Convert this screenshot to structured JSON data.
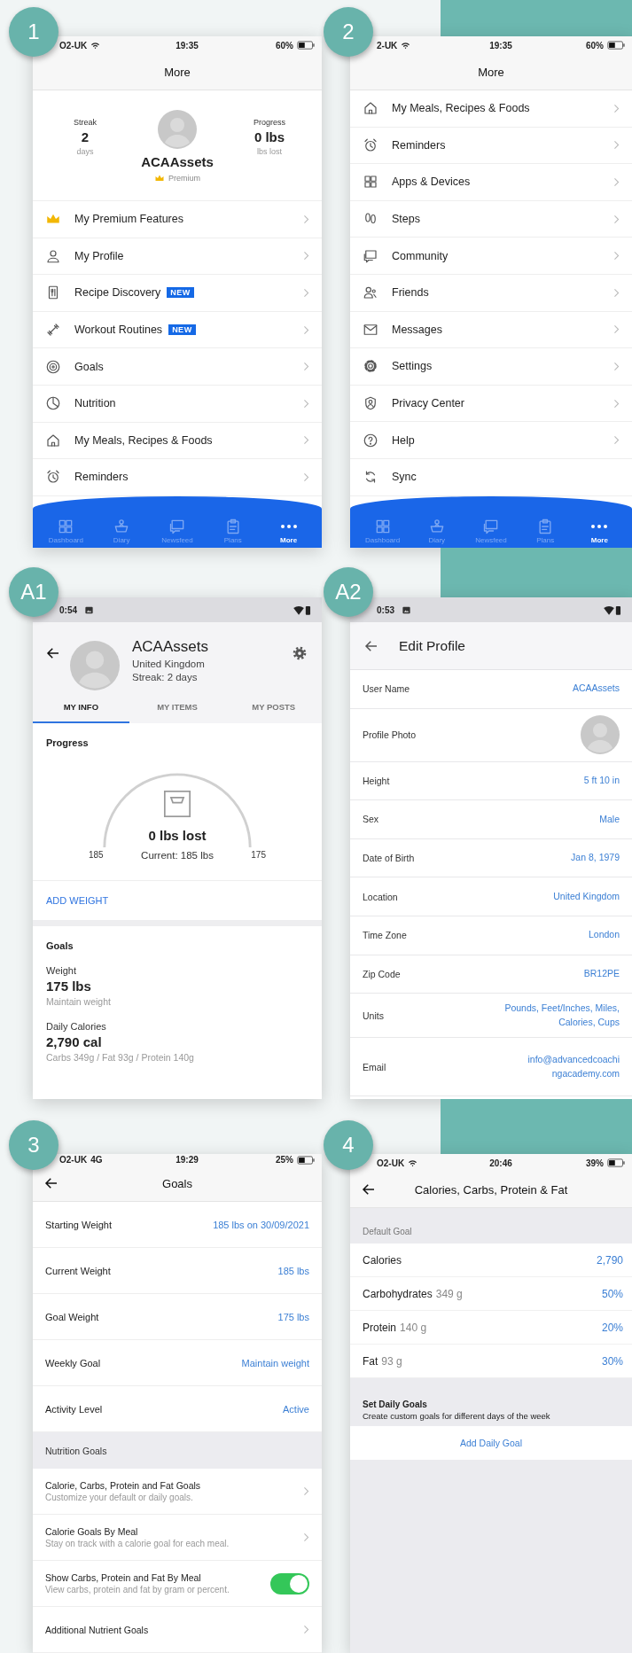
{
  "panels": [
    {
      "badge": "1",
      "kind": "ios_more_profile",
      "status": {
        "carrier": "O2-UK",
        "time": "19:35",
        "battery": "60%"
      },
      "title": "More",
      "profile": {
        "streak_label": "Streak",
        "streak_value": "2",
        "streak_unit": "days",
        "name": "ACAAssets",
        "tier": "Premium",
        "progress_label": "Progress",
        "progress_value": "0 lbs",
        "progress_unit": "lbs lost"
      },
      "menu": [
        {
          "label": "My Premium Features",
          "chevron": true
        },
        {
          "label": "My Profile",
          "chevron": true
        },
        {
          "label": "Recipe Discovery",
          "badge": "NEW",
          "chevron": true
        },
        {
          "label": "Workout Routines",
          "badge": "NEW",
          "chevron": true
        },
        {
          "label": "Goals",
          "chevron": true
        },
        {
          "label": "Nutrition",
          "chevron": true
        },
        {
          "label": "My Meals, Recipes & Foods",
          "chevron": true
        },
        {
          "label": "Reminders",
          "chevron": true
        }
      ],
      "tabbar": [
        {
          "label": "Dashboard",
          "selected": false
        },
        {
          "label": "Diary",
          "selected": false
        },
        {
          "label": "Newsfeed",
          "selected": false
        },
        {
          "label": "Plans",
          "selected": false
        },
        {
          "label": "More",
          "selected": true
        }
      ]
    },
    {
      "badge": "2",
      "kind": "ios_more_list",
      "status": {
        "carrier": "2-UK",
        "time": "19:35",
        "battery": "60%"
      },
      "title": "More",
      "menu": [
        {
          "label": "My Meals, Recipes & Foods",
          "chevron": true
        },
        {
          "label": "Reminders",
          "chevron": true
        },
        {
          "label": "Apps & Devices",
          "chevron": true
        },
        {
          "label": "Steps",
          "chevron": true
        },
        {
          "label": "Community",
          "chevron": true
        },
        {
          "label": "Friends",
          "chevron": true
        },
        {
          "label": "Messages",
          "chevron": true
        },
        {
          "label": "Settings",
          "chevron": true
        },
        {
          "label": "Privacy Center",
          "chevron": true
        },
        {
          "label": "Help",
          "chevron": true
        },
        {
          "label": "Sync",
          "chevron": false
        }
      ],
      "tabbar": [
        {
          "label": "Dashboard",
          "selected": false
        },
        {
          "label": "Diary",
          "selected": false
        },
        {
          "label": "Newsfeed",
          "selected": false
        },
        {
          "label": "Plans",
          "selected": false
        },
        {
          "label": "More",
          "selected": true
        }
      ]
    },
    {
      "badge": "A1",
      "kind": "android_profile",
      "status": {
        "time": "0:54"
      },
      "profile": {
        "name": "ACAAssets",
        "location": "United Kingdom",
        "streak": "Streak: 2 days"
      },
      "tabs": [
        {
          "label": "MY INFO",
          "selected": true
        },
        {
          "label": "MY ITEMS",
          "selected": false
        },
        {
          "label": "MY POSTS",
          "selected": false
        }
      ],
      "progress": {
        "title": "Progress",
        "lost": "0 lbs lost",
        "start": "185",
        "current": "Current: 185 lbs",
        "goal": "175"
      },
      "action": "ADD WEIGHT",
      "goals": {
        "title": "Goals",
        "items": [
          {
            "label": "Weight",
            "value": "175 lbs",
            "note": "Maintain weight"
          },
          {
            "label": "Daily Calories",
            "value": "2,790 cal",
            "note": "Carbs 349g / Fat 93g / Protein 140g"
          }
        ]
      }
    },
    {
      "badge": "A2",
      "kind": "android_edit",
      "status": {
        "time": "0:53"
      },
      "title": "Edit Profile",
      "rows": [
        {
          "kind": "text",
          "label": "User Name",
          "value": "ACAAssets"
        },
        {
          "kind": "photo",
          "label": "Profile Photo"
        },
        {
          "kind": "text",
          "label": "Height",
          "value": "5 ft 10 in"
        },
        {
          "kind": "text",
          "label": "Sex",
          "value": "Male"
        },
        {
          "kind": "text",
          "label": "Date of Birth",
          "value": "Jan 8, 1979"
        },
        {
          "kind": "text",
          "label": "Location",
          "value": "United Kingdom"
        },
        {
          "kind": "text",
          "label": "Time Zone",
          "value": "London"
        },
        {
          "kind": "text",
          "label": "Zip Code",
          "value": "BR12PE"
        },
        {
          "kind": "text",
          "label": "Units",
          "value": "Pounds, Feet/Inches, Miles, Calories, Cups"
        },
        {
          "kind": "email",
          "label": "Email",
          "value": "info@advancedcoachingacademy.com"
        }
      ]
    },
    {
      "badge": "3",
      "kind": "ios_goals",
      "status": {
        "carrier": "O2-UK",
        "network": "4G",
        "time": "19:29",
        "battery": "25%"
      },
      "title": "Goals",
      "rows": [
        {
          "label": "Starting Weight",
          "value": "185 lbs on 30/09/2021"
        },
        {
          "label": "Current Weight",
          "value": "185 lbs"
        },
        {
          "label": "Goal Weight",
          "value": "175 lbs"
        },
        {
          "label": "Weekly Goal",
          "value": "Maintain weight"
        },
        {
          "label": "Activity Level",
          "value": "Active"
        }
      ],
      "section": "Nutrition Goals",
      "nutrition": [
        {
          "kind": "link",
          "title": "Calorie, Carbs, Protein and Fat Goals",
          "subtitle": "Customize your default or daily goals."
        },
        {
          "kind": "link",
          "title": "Calorie Goals By Meal",
          "subtitle": "Stay on track with a calorie goal for each meal."
        },
        {
          "kind": "toggle",
          "title": "Show Carbs, Protein and Fat By Meal",
          "subtitle": "View carbs, protein and fat by gram or percent.",
          "on": true
        },
        {
          "kind": "link",
          "title": "Additional Nutrient Goals"
        }
      ]
    },
    {
      "badge": "4",
      "kind": "ios_macros",
      "status": {
        "carrier": "O2-UK",
        "time": "20:46",
        "battery": "39%"
      },
      "title": "Calories, Carbs, Protein & Fat",
      "section": "Default Goal",
      "rows": [
        {
          "label": "Calories",
          "value": "2,790"
        },
        {
          "label": "Carbohydrates",
          "amount": "349 g",
          "value": "50%"
        },
        {
          "label": "Protein",
          "amount": "140 g",
          "value": "20%"
        },
        {
          "label": "Fat",
          "amount": "93 g",
          "value": "30%"
        }
      ],
      "daily": {
        "title": "Set Daily Goals",
        "subtitle": "Create custom goals for different days of the week",
        "action": "Add Daily Goal"
      }
    }
  ]
}
